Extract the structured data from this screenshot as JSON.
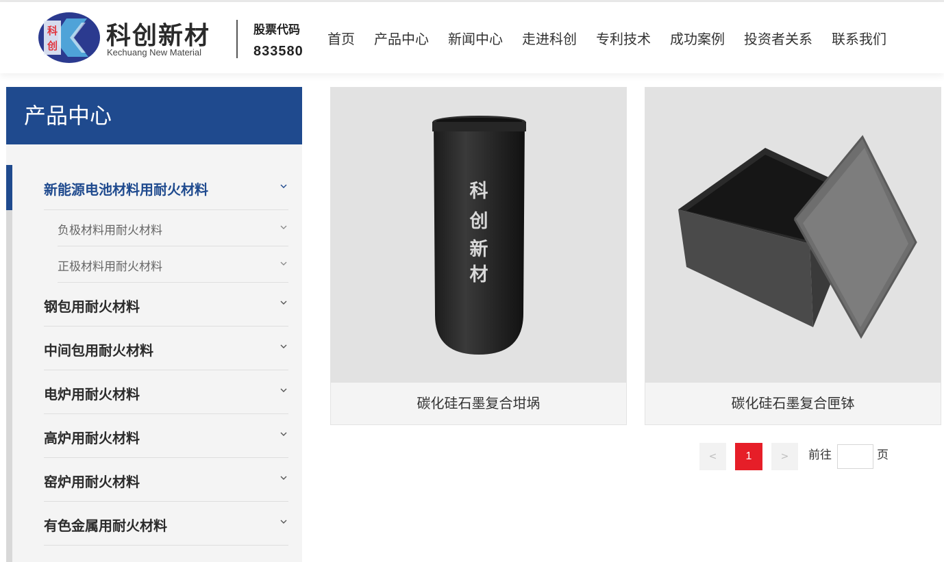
{
  "brand": {
    "mark_text": [
      "科",
      "创"
    ],
    "name_cn": "科创新材",
    "name_en": "Kechuang New Material",
    "stock_label": "股票代码",
    "stock_code": "833580",
    "colors": {
      "navy": "#2b3a8f",
      "light_blue": "#4fa3d8",
      "red": "#e2343c"
    }
  },
  "nav": {
    "items": [
      {
        "label": "首页"
      },
      {
        "label": "产品中心"
      },
      {
        "label": "新闻中心"
      },
      {
        "label": "走进科创"
      },
      {
        "label": "专利技术"
      },
      {
        "label": "成功案例"
      },
      {
        "label": "投资者关系"
      },
      {
        "label": "联系我们"
      }
    ]
  },
  "sidebar": {
    "title": "产品中心",
    "accent_color": "#1f4a8e",
    "active": {
      "label": "新能源电池材料用耐火材料",
      "children": [
        {
          "label": "负极材料用耐火材料"
        },
        {
          "label": "正极材料用耐火材料"
        }
      ]
    },
    "items": [
      {
        "label": "钢包用耐火材料"
      },
      {
        "label": "中间包用耐火材料"
      },
      {
        "label": "电炉用耐火材料"
      },
      {
        "label": "高炉用耐火材料"
      },
      {
        "label": "窑炉用耐火材料"
      },
      {
        "label": "有色金属用耐火材料"
      }
    ],
    "chevron_icon": "chevron-down-icon"
  },
  "products": [
    {
      "title": "碳化硅石墨复合坩埚",
      "image_text": [
        "科",
        "创",
        "新",
        "材"
      ]
    },
    {
      "title": "碳化硅石墨复合匣钵"
    }
  ],
  "pagination": {
    "prev_icon": "<",
    "next_icon": ">",
    "current_page": "1",
    "goto_label": "前往",
    "goto_value": "",
    "page_suffix": "页",
    "active_color": "#e61e28"
  }
}
